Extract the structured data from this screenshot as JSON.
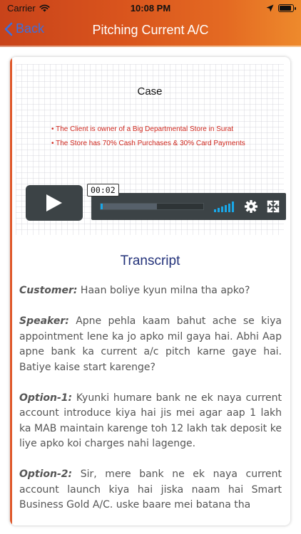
{
  "status_bar": {
    "carrier": "Carrier",
    "time": "10:08 PM",
    "battery_level": 0.9
  },
  "nav": {
    "back_label": "Back",
    "title": "Pitching Current A/C"
  },
  "slide": {
    "title": "Case",
    "bullets": [
      "• The Client is owner of a Big Departmental Store in Surat",
      "• The Store has 70% Cash Purchases & 30% Card Payments"
    ]
  },
  "player": {
    "current_time": "00:02",
    "buffered_fraction": 0.55,
    "played_fraction": 0.02
  },
  "transcript": {
    "heading": "Transcript",
    "entries": [
      {
        "speaker": "Customer:",
        "text": " Haan boliye kyun milna tha apko?"
      },
      {
        "speaker": "Speaker:",
        "text": " Apne pehla kaam bahut ache se kiya appointment lene ka jo apko mil gaya hai. Abhi Aap apne bank ka current a/c pitch karne gaye hai. Batiye kaise start karenge?"
      },
      {
        "speaker": "Option-1:",
        "text": " Kyunki humare bank ne ek naya current account introduce kiya hai jis mei agar aap 1 lakh ka MAB maintain karenge toh 12 lakh tak deposit ke liye apko koi charges nahi lagenge."
      },
      {
        "speaker": "Option-2:",
        "text": " Sir, mere bank ne ek naya current account launch kiya hai jiska naam hai Smart Business Gold A/C. uske baare mei batana tha"
      }
    ]
  },
  "colors": {
    "nav_start": "#c8431a",
    "nav_end": "#ee8a2c",
    "accent_blue": "#19a7e8",
    "heading_blue": "#23327a",
    "bullet_red": "#d0281e"
  }
}
